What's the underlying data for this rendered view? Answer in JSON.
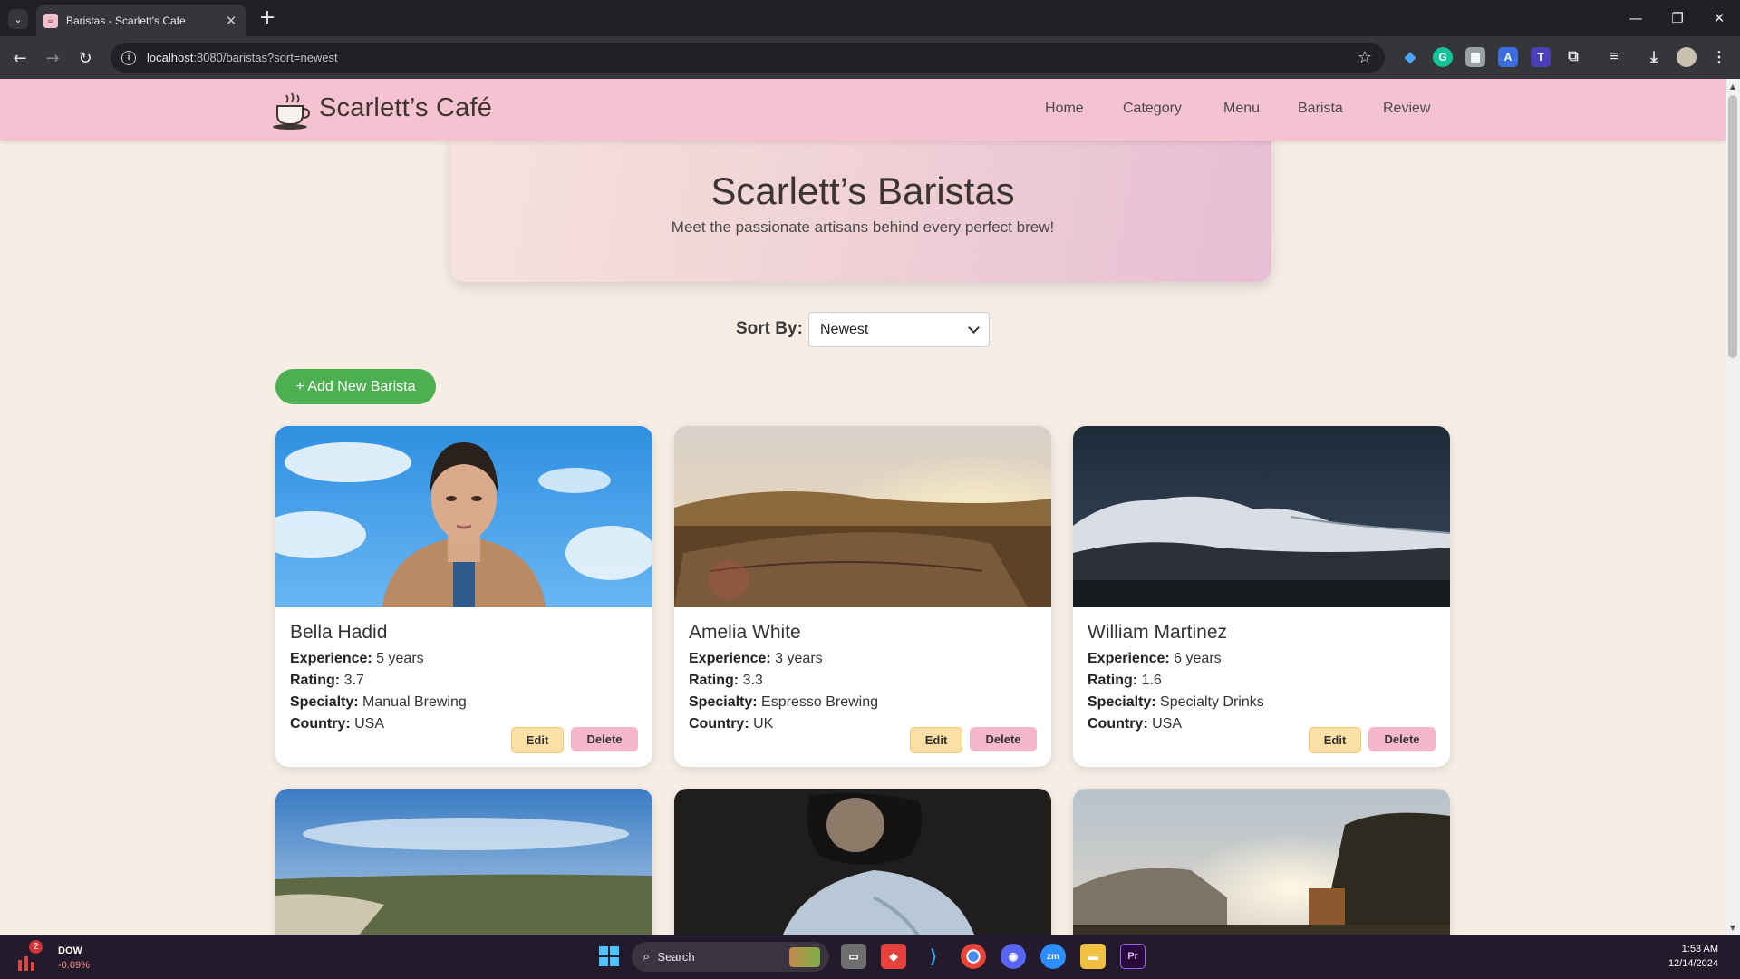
{
  "browser": {
    "tab_title": "Baristas - Scarlett's Cafe",
    "url_host": "localhost",
    "url_rest": ":8080/baristas?sort=newest"
  },
  "site": {
    "brand": "Scarlett’s Café",
    "nav": [
      "Home",
      "Category",
      "Menu",
      "Barista",
      "Review"
    ]
  },
  "hero": {
    "title": "Scarlett’s Baristas",
    "subtitle": "Meet the passionate artisans behind every perfect brew!"
  },
  "sort": {
    "label": "Sort By:",
    "value": "Newest"
  },
  "add_button": "+ Add New Barista",
  "field_labels": {
    "experience": "Experience:",
    "rating": "Rating:",
    "specialty": "Specialty:",
    "country": "Country:"
  },
  "card_buttons": {
    "edit": "Edit",
    "delete": "Delete"
  },
  "baristas": [
    {
      "name": "Bella Hadid",
      "experience": "5 years",
      "rating": "3.7",
      "specialty": "Manual Brewing",
      "country": "USA",
      "image": "portrait-sky"
    },
    {
      "name": "Amelia White",
      "experience": "3 years",
      "rating": "3.3",
      "specialty": "Espresso Brewing",
      "country": "UK",
      "image": "sunset-stump"
    },
    {
      "name": "William Martinez",
      "experience": "6 years",
      "rating": "1.6",
      "specialty": "Specialty Drinks",
      "country": "USA",
      "image": "night-mountains"
    },
    {
      "image": "coastal-cliff"
    },
    {
      "image": "reading-woman"
    },
    {
      "image": "sunset-forest"
    }
  ],
  "taskbar": {
    "widget_name": "DOW",
    "widget_change": "-0.09%",
    "widget_badge": "2",
    "search_label": "Search",
    "time": "1:53 AM",
    "date": "12/14/2024"
  },
  "colors": {
    "nav_bg": "#f5c2d2",
    "page_bg": "#f6ede4",
    "add_button": "#4caf50",
    "edit_button": "#fde0a6",
    "delete_button": "#f5b7cc"
  }
}
